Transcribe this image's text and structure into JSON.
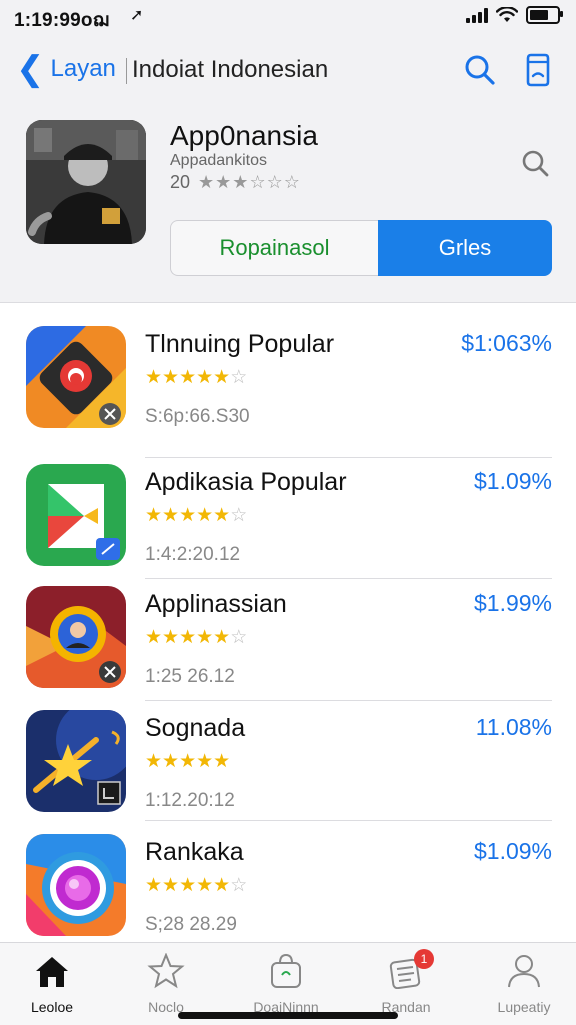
{
  "status": {
    "time": "1:19:99oฌ",
    "arrow": "➚"
  },
  "nav": {
    "back_label": "Layan",
    "title": "Indoiat Indonesian"
  },
  "header": {
    "title": "App0nansia",
    "subtitle": "Appadankitos",
    "rating_count": "20",
    "rating_stars": "★★★☆☆☆",
    "segment_left": "Ropainasol",
    "segment_right": "Grles"
  },
  "apps": [
    {
      "name": "Tlnnuing Popular",
      "price": "$1:063%",
      "meta": "S:6p:66.S30",
      "rating": 4.5,
      "icon": "red-target-app-icon"
    },
    {
      "name": "Apdikasia Popular",
      "price": "$1.09%",
      "meta": "1:4:2:20.12",
      "rating": 4.5,
      "icon": "play-store-app-icon"
    },
    {
      "name": "Applinassian",
      "price": "$1.99%",
      "meta": "1:25 26.12",
      "rating": 4.5,
      "icon": "avatar-badge-app-icon"
    },
    {
      "name": "Sognada",
      "price": "11.08%",
      "meta": "1:12.20:12",
      "rating": 5,
      "icon": "star-game-app-icon"
    },
    {
      "name": "Rankaka",
      "price": "$1.09%",
      "meta": "S;28 28.29",
      "rating": 4.5,
      "icon": "camera-swirl-app-icon"
    }
  ],
  "tabs": [
    {
      "label": "Leoloe",
      "icon": "home-icon",
      "active": true
    },
    {
      "label": "Noclo",
      "icon": "star-icon",
      "active": false
    },
    {
      "label": "DoaiNinnn",
      "icon": "bag-icon",
      "active": false
    },
    {
      "label": "Randan",
      "icon": "news-icon",
      "active": false,
      "badge": "1"
    },
    {
      "label": "Lupeatiy",
      "icon": "person-icon",
      "active": false
    }
  ],
  "colors": {
    "accent": "#1a73e8",
    "segment_active": "#1a7fe8",
    "star": "#f2b705",
    "badge": "#e53935",
    "segment_text": "#1a8f2e"
  }
}
